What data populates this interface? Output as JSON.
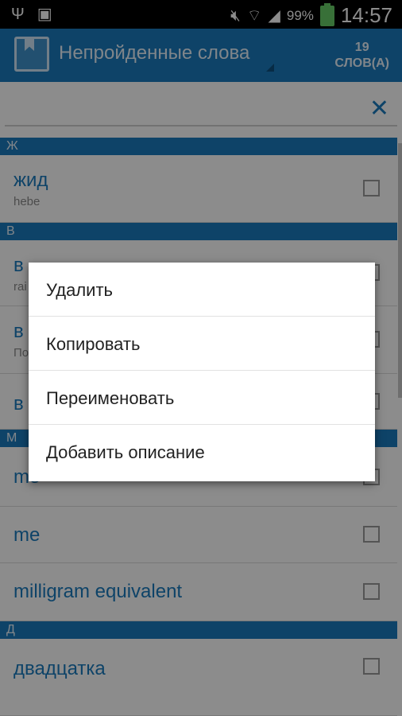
{
  "status_bar": {
    "left_icons": [
      "usb-icon",
      "image-icon"
    ],
    "right_icons": [
      "mute-icon",
      "wifi-icon",
      "signal-icon",
      "battery-icon"
    ],
    "battery_percent": "99%",
    "time": "14:57"
  },
  "app_bar": {
    "title": "Непройденные слова",
    "count": "19",
    "count_unit": "СЛОВ(А)"
  },
  "search": {
    "value": "",
    "placeholder": "",
    "clear_icon": "close-icon"
  },
  "list": {
    "sections": [
      {
        "letter": "Ж"
      },
      {
        "letter": "В"
      },
      {
        "letter": "М"
      },
      {
        "letter": "Д"
      }
    ],
    "rows": [
      {
        "word": "жид",
        "desc": "hebe",
        "checked": false
      },
      {
        "word": "в",
        "desc": "rai",
        "checked": false
      },
      {
        "word": "в",
        "desc": "По",
        "checked": false
      },
      {
        "word": "в",
        "desc": "",
        "checked": false
      },
      {
        "word": "me",
        "desc": "",
        "checked": false
      },
      {
        "word": "me",
        "desc": "",
        "checked": false
      },
      {
        "word": "milligram equivalent",
        "desc": "",
        "checked": false
      },
      {
        "word": "двадцатка",
        "desc": "",
        "checked": false
      }
    ]
  },
  "context_menu": {
    "items": [
      "Удалить",
      "Копировать",
      "Переименовать",
      "Добавить описание"
    ]
  },
  "colors": {
    "accent": "#1a7bbd",
    "status_bar": "#000000",
    "battery": "#66cc66"
  }
}
